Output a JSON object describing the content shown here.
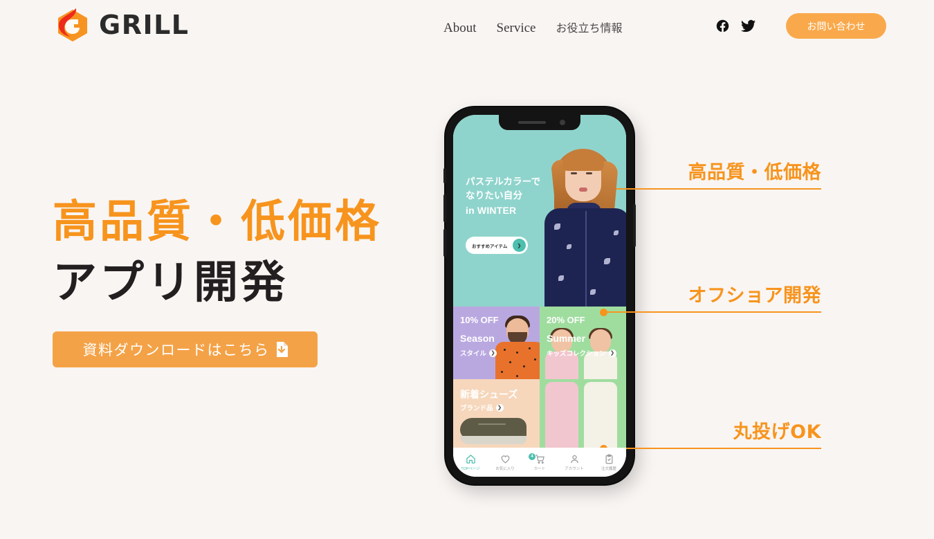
{
  "header": {
    "logo": {
      "text": "GRILL",
      "icon": "flame-logo-icon"
    },
    "nav": [
      {
        "label": "About",
        "name": "about"
      },
      {
        "label": "Service",
        "name": "service"
      },
      {
        "label": "お役立ち情報",
        "name": "useful-info"
      }
    ],
    "social": [
      {
        "label": "Facebook",
        "icon": "facebook-icon"
      },
      {
        "label": "Twitter",
        "icon": "twitter-icon"
      }
    ],
    "contact_button": "お問い合わせ"
  },
  "hero": {
    "title_line_1": "高品質・低価格",
    "title_line_2": "アプリ開発",
    "cta_label": "資料ダウンロードはこちら",
    "cta_icon": "download-document-icon"
  },
  "annotations": [
    {
      "label": "高品質・低価格"
    },
    {
      "label": "オフショア開発"
    },
    {
      "label": "丸投げOK"
    }
  ],
  "phone": {
    "app_hero": {
      "line1": "パステルカラーで",
      "line2": "なりたい自分",
      "line3": "in WINTER",
      "pill_label": "おすすめアイテム",
      "pill_icon": "chevron-right-icon"
    },
    "cards": [
      {
        "pct": "10% OFF",
        "name": "Season",
        "sub": "スタイル"
      },
      {
        "pct": "20% OFF",
        "name": "Summer",
        "sub": "キッズコレクション"
      },
      {
        "pct": "",
        "name": "新着シューズ",
        "sub": "ブランド品"
      }
    ],
    "tabs": [
      {
        "label": "TOPページ",
        "icon": "home-icon",
        "active": true,
        "badge": ""
      },
      {
        "label": "お気に入り",
        "icon": "heart-icon",
        "active": false,
        "badge": ""
      },
      {
        "label": "カート",
        "icon": "cart-icon",
        "active": false,
        "badge": "4"
      },
      {
        "label": "アカウント",
        "icon": "person-icon",
        "active": false,
        "badge": ""
      },
      {
        "label": "注文履歴",
        "icon": "clipboard-icon",
        "active": false,
        "badge": ""
      }
    ]
  },
  "colors": {
    "background": "#f9f5f3",
    "accent_orange": "#f7941d",
    "button_orange": "#f4a247",
    "app_teal": "#8fd4cc",
    "card_purple": "#b9a8e0",
    "card_green": "#9fdd9f",
    "card_peach": "#f6d7bc",
    "text_dark": "#231f20"
  }
}
